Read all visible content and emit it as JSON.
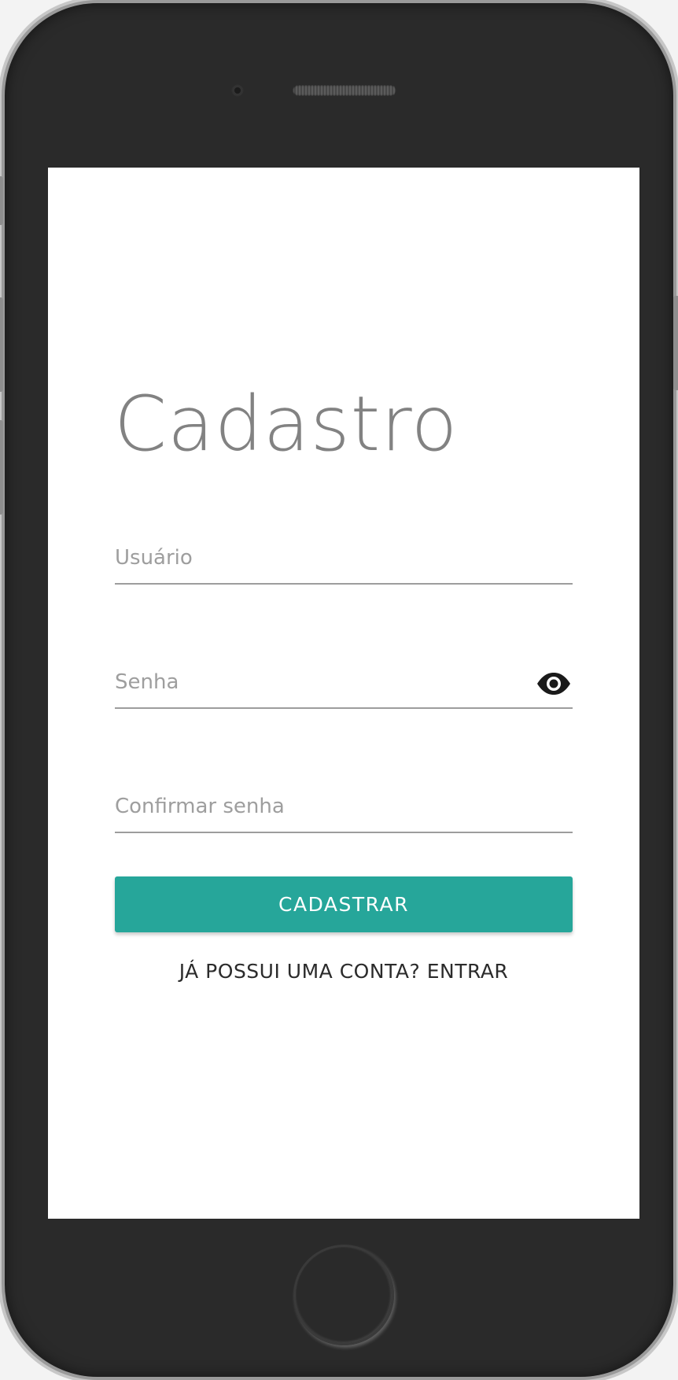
{
  "screen": {
    "title": "Cadastro",
    "fields": {
      "username": {
        "placeholder": "Usuário",
        "value": ""
      },
      "password": {
        "placeholder": "Senha",
        "value": ""
      },
      "confirm_password": {
        "placeholder": "Confirmar senha",
        "value": ""
      }
    },
    "password_toggle_icon": "eye-icon",
    "submit_label": "CADASTRAR",
    "login_link": "JÁ POSSUI UMA CONTA? ENTRAR"
  },
  "colors": {
    "accent": "#26a69a",
    "title": "#828282",
    "placeholder": "#9e9e9e",
    "device_body": "#2a2a2a"
  }
}
